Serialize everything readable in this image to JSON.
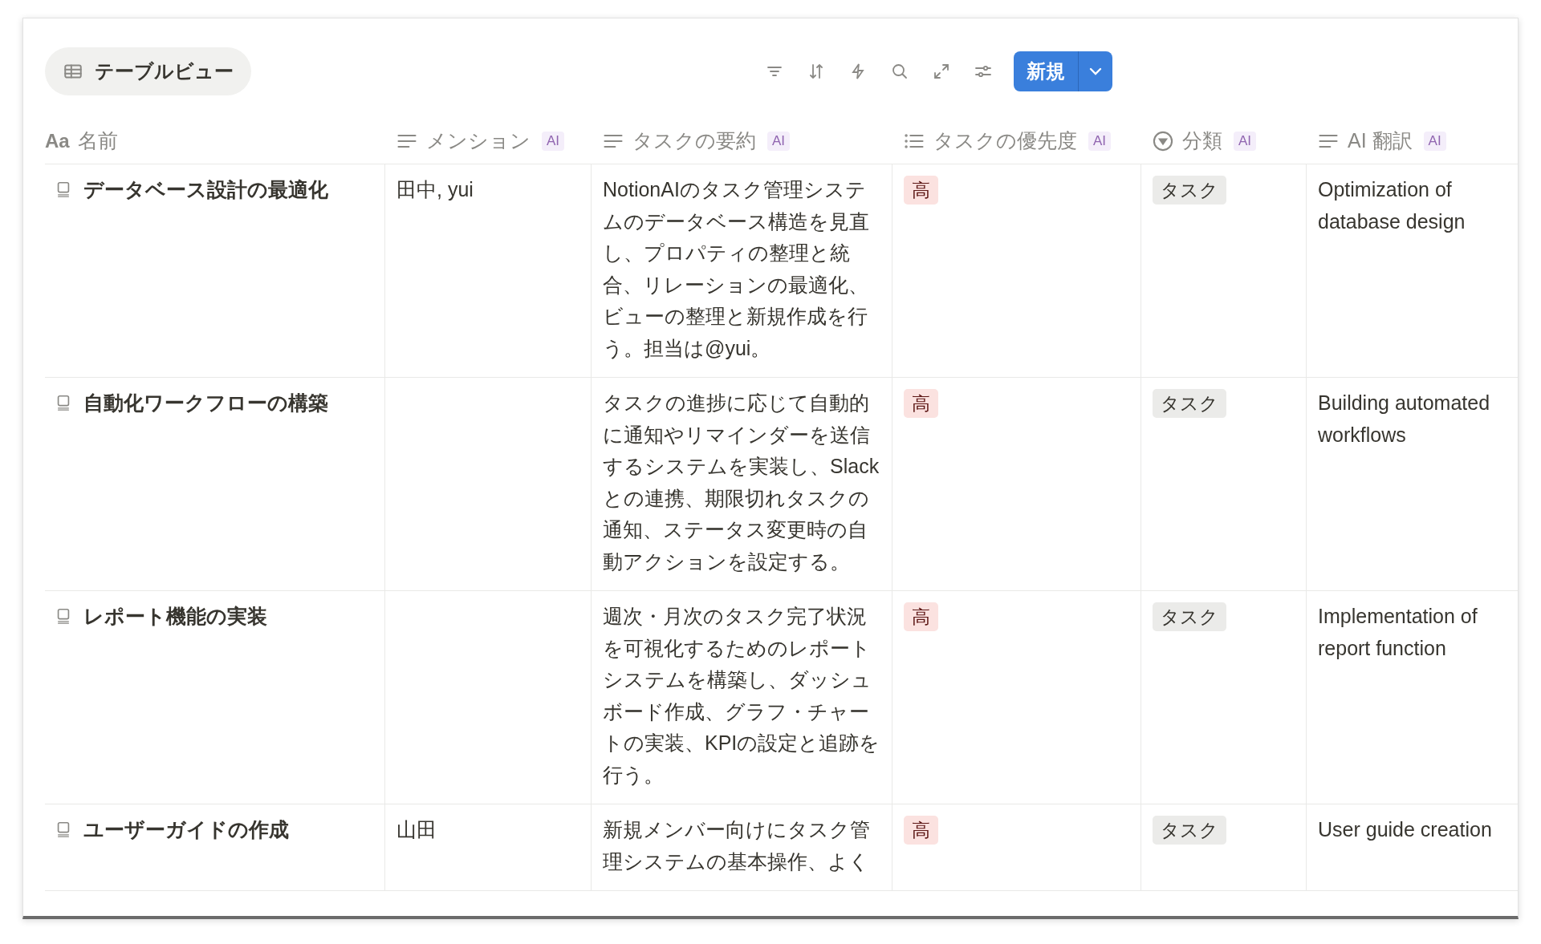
{
  "toolbar": {
    "view_tab": {
      "label": "テーブルビュー",
      "selected": true
    },
    "new_button": {
      "label": "新規"
    }
  },
  "table": {
    "columns": [
      {
        "label": "名前",
        "kind": "title",
        "type_label": "Aa"
      },
      {
        "label": "メンション",
        "kind": "text",
        "badge": "AI"
      },
      {
        "label": "タスクの要約",
        "kind": "text",
        "badge": "AI"
      },
      {
        "label": "タスクの優先度",
        "kind": "list",
        "badge": "AI"
      },
      {
        "label": "分類",
        "kind": "select",
        "badge": "AI"
      },
      {
        "label": "AI 翻訳",
        "kind": "text",
        "badge": "AI"
      }
    ],
    "rows": [
      {
        "name": "データベース設計の最適化",
        "mention": "田中, yui",
        "summary": "NotionAIのタスク管理システムのデータベース構造を見直し、プロパティの整理と統合、リレーションの最適化、ビューの整理と新規作成を行う。担当は@yui。",
        "priority": "高",
        "category": "タスク",
        "translation": "Optimization of database design"
      },
      {
        "name": "自動化ワークフローの構築",
        "summary": "タスクの進捗に応じて自動的に通知やリマインダーを送信するシステムを実装し、Slackとの連携、期限切れタスクの通知、ステータス変更時の自動アクションを設定する。",
        "priority": "高",
        "category": "タスク",
        "translation": "Building automated workflows"
      },
      {
        "name": "レポート機能の実装",
        "summary": "週次・月次のタスク完了状況を可視化するためのレポートシステムを構築し、ダッシュボード作成、グラフ・チャートの実装、KPIの設定と追跡を行う。",
        "priority": "高",
        "category": "タスク",
        "translation": "Implementation of report function"
      },
      {
        "name": "ユーザーガイドの作成",
        "mention": "山田",
        "summary": "新規メンバー向けにタスク管理システムの基本操作、よく",
        "priority": "高",
        "category": "タスク",
        "translation": "User guide creation"
      }
    ]
  }
}
